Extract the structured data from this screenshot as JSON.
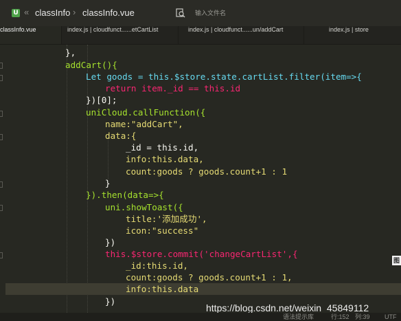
{
  "header": {
    "logo_letter": "U",
    "back_chevron": "«",
    "breadcrumb": [
      "classInfo",
      "classInfo.vue"
    ],
    "breadcrumb_separator": "›",
    "search_placeholder": "输入文件名"
  },
  "tabs": [
    {
      "label": "classInfo.vue",
      "active": true
    },
    {
      "label": "index.js | cloudfunct......etCartList",
      "active": false
    },
    {
      "label": "index.js | cloudfunct......un/addCart",
      "active": false
    },
    {
      "label": "index.js | store",
      "active": false
    }
  ],
  "code_lines": [
    "},",
    "addCart(){",
    "Let goods = this.$store.state.cartList.filter(item=>{",
    "return item._id == this.id",
    "})[0];",
    "uniCloud.callFunction({",
    "name:\"addCart\",",
    "data:{",
    "_id = this.id,",
    "info:this.data,",
    "count:goods ? goods.count+1 : 1",
    "}",
    "}).then(data=>{",
    "uni.showToast({",
    "title:'添加成功',",
    "icon:\"success\"",
    "})",
    "this.$store.commit('changeCartList',{",
    "_id:this.id,",
    "count:goods ? goods.count+1 : 1,",
    "info:this.data",
    "})"
  ],
  "minimap_marker": "图",
  "watermark": "https://blog.csdn.net/weixin_45849112",
  "status": {
    "hint": "语法提示库",
    "row": "行:152",
    "col": "列:39",
    "encoding": "UTF"
  },
  "colors": {
    "background": "#272822",
    "keyword": "#f92672",
    "function": "#66d9ef",
    "string": "#e6db74",
    "number": "#ae81ff",
    "property": "#a6e22e",
    "parameter": "#fd971f"
  }
}
